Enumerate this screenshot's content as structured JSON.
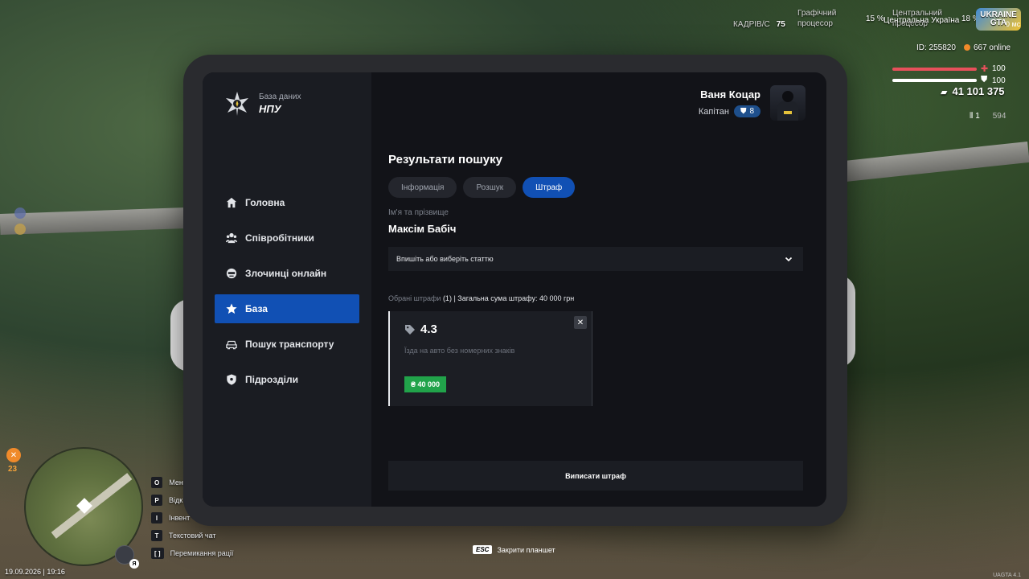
{
  "hud": {
    "kadriv_label": "КАДРІВ/С",
    "kadriv_value": "75",
    "gpu_label_1": "Графічний",
    "gpu_label_2": "процесор",
    "gpu_value": "15 %",
    "cpu_label_1": "Центральний",
    "cpu_label_2": "процесор",
    "cpu_value": "18 %",
    "server_name": "Центральна Україна",
    "game_logo": "UKRAINE GTA",
    "ping": "0 мс",
    "player_id": "ID: 255820",
    "online": "667 online",
    "health": "100",
    "armor": "100",
    "money": "41 101 375",
    "ammo_clip": "1",
    "ammo_total": "594",
    "wanted_level": "23",
    "datetime": "19.09.2026 | 19:16",
    "mic_key": "Я",
    "version": "UAGTA 4.1"
  },
  "keybinds": [
    {
      "key": "O",
      "label": "Мен"
    },
    {
      "key": "P",
      "label": "Відк"
    },
    {
      "key": "I",
      "label": "Інвент"
    },
    {
      "key": "T",
      "label": "Текстовий чат"
    },
    {
      "key": "[ ]",
      "label": "Перемикання рації"
    }
  ],
  "esc_hint": {
    "key": "ESC",
    "label": "Закрити планшет"
  },
  "tablet": {
    "brand_sub": "База даних",
    "brand_title": "НПУ",
    "nav": [
      {
        "label": "Головна",
        "icon": "home-icon"
      },
      {
        "label": "Співробітники",
        "icon": "users-icon"
      },
      {
        "label": "Злочинці онлайн",
        "icon": "criminal-icon"
      },
      {
        "label": "База",
        "icon": "star-icon",
        "active": true
      },
      {
        "label": "Пошук транспорту",
        "icon": "car-icon"
      },
      {
        "label": "Підрозділи",
        "icon": "shield-icon"
      }
    ],
    "user": {
      "name": "Ваня Коцар",
      "rank": "Капітан",
      "level": "8"
    },
    "title": "Результати пошуку",
    "tabs": [
      "Інформація",
      "Розшук",
      "Штраф"
    ],
    "active_tab": "Штраф",
    "name_label": "Ім'я та прізвище",
    "person_name": "Максім Бабіч",
    "article_placeholder": "Впишіть або виберіть статтю",
    "summary_label": "Обрані штрафи",
    "summary_count": "(1)",
    "summary_total": "| Загальна сума штрафу: 40 000 грн",
    "fine_card": {
      "article": "4.3",
      "description": "Їзда на авто без номерних знаків",
      "price": "₴ 40 000"
    },
    "submit_label": "Виписати штраф"
  },
  "colors": {
    "accent": "#1150b4",
    "price": "#21a34a",
    "health": "#e8505b",
    "sidebar": "#1a1c22",
    "screen": "#121318"
  }
}
